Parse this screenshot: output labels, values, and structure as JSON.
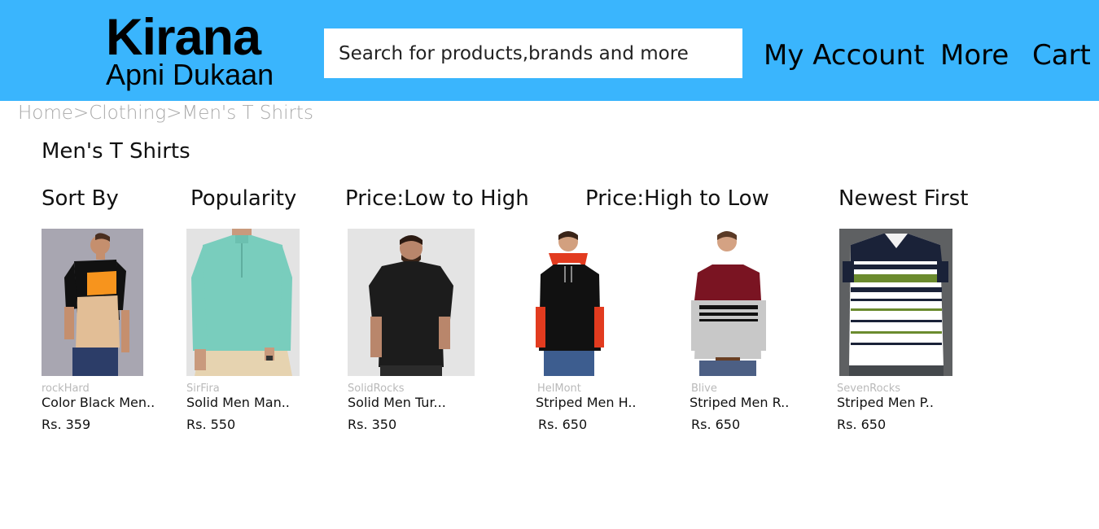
{
  "header": {
    "logo_title": "Kirana",
    "logo_subtitle": "Apni Dukaan",
    "search_placeholder": "Search for products,brands and more",
    "nav": [
      "My Account",
      "More",
      "Cart"
    ],
    "background_color": "#3ab5fd"
  },
  "breadcrumb": "Home>Clothing>Men's T Shirts",
  "page_title": "Men's T Shirts",
  "sort_bar": [
    "Sort By",
    "Popularity",
    "Price:Low to High",
    "Price:High to Low",
    "Newest First"
  ],
  "products": [
    {
      "brand": "rockHard",
      "name": "Color Black Men..",
      "price": "Rs. 359",
      "image": "black-orange-colorblock-tshirt-photo"
    },
    {
      "brand": "SirFira",
      "name": "Solid Men Man..",
      "price": "Rs. 550",
      "image": "mint-green-henley-tshirt-photo"
    },
    {
      "brand": "SolidRocks",
      "name": "Solid Men Tur...",
      "price": "Rs. 350",
      "image": "black-crew-neck-tshirt-photo"
    },
    {
      "brand": "HelMont",
      "name": "Striped Men H..",
      "price": "Rs. 650",
      "image": "black-red-hooded-tshirt-photo"
    },
    {
      "brand": "Blive",
      "name": "Striped Men R..",
      "price": "Rs. 650",
      "image": "maroon-grey-striped-tshirt-photo"
    },
    {
      "brand": "SevenRocks",
      "name": "Striped Men P..",
      "price": "Rs. 650",
      "image": "navy-green-striped-polo-photo"
    }
  ]
}
